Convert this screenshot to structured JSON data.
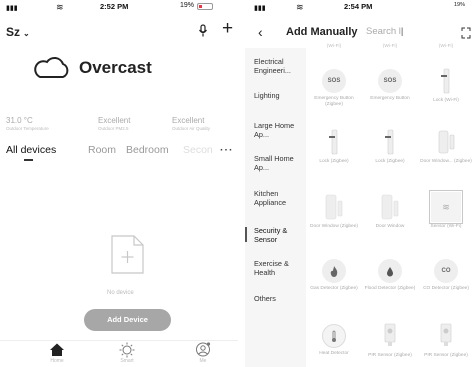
{
  "left_phone": {
    "status": {
      "signal": "▮▮▮",
      "time": "2:52 PM",
      "battery": "19%"
    },
    "header": {
      "home": "Sz",
      "chevron": "⌄"
    },
    "weather": {
      "condition": "Overcast",
      "stats": [
        {
          "value": "31.0 °C",
          "label": "Outdoor Temperature"
        },
        {
          "value": "Excellent",
          "label": "Outdoor PM2.5"
        },
        {
          "value": "Excellent",
          "label": "Outdoor Air Quality"
        }
      ]
    },
    "tabs": [
      "All devices",
      "Room",
      "Bedroom",
      "Secon",
      "···"
    ],
    "empty": {
      "text": "No device",
      "button": "Add Device"
    },
    "nav": [
      {
        "label": "Home",
        "icon": "home-icon"
      },
      {
        "label": "Smart",
        "icon": "sun-icon"
      },
      {
        "label": "Me",
        "icon": "user-icon"
      }
    ]
  },
  "right_phone": {
    "status": {
      "signal": "▮▮▮",
      "time": "2:54 PM",
      "battery": "19%"
    },
    "header": {
      "back": "‹",
      "title": "Add Manually",
      "search_placeholder": "Search l",
      "cursor": "|"
    },
    "categories": [
      "Electrical Engineeri...",
      "Lighting",
      "Large Home Ap...",
      "Small Home Ap...",
      "Kitchen Appliance",
      "Security & Sensor",
      "Exercise & Health",
      "Others"
    ],
    "selected_category": "Security & Sensor",
    "top_cut_labels": [
      "(Wi-Fi)",
      "(Wi-Fi)",
      "(Wi-Fi)"
    ],
    "products": [
      {
        "name": "SOS",
        "label": "",
        "icon": "sos-icon"
      },
      {
        "name": "SOS",
        "label": "",
        "icon": "sos-icon"
      },
      {
        "name": "",
        "label": "Lock (Wi-Fi)",
        "icon": "lock-icon"
      },
      {
        "name": "",
        "label": "Emergency Button (Zigbee)",
        "icon": ""
      },
      {
        "name": "",
        "label": "Emergency Button",
        "icon": ""
      },
      {
        "name": "",
        "label": "",
        "icon": ""
      },
      {
        "name": "",
        "label": "Lock (Zigbee)",
        "icon": "lock-icon"
      },
      {
        "name": "",
        "label": "Lock (Zigbee)",
        "icon": "lock-icon"
      },
      {
        "name": "",
        "label": "Door Window... (Zigbee)",
        "icon": "door-sensor-icon"
      },
      {
        "name": "",
        "label": "Door Window (Zigbee)",
        "icon": "door-sensor-icon"
      },
      {
        "name": "",
        "label": "Door Window",
        "icon": "door-sensor-icon"
      },
      {
        "name": "",
        "label": "Sensor (Wi-Fi)",
        "icon": "sensor-icon"
      },
      {
        "name": "",
        "label": "Gas Detector (Zigbee)",
        "icon": "flame-icon"
      },
      {
        "name": "",
        "label": "Flood Detector (Zigbee)",
        "icon": "drop-icon"
      },
      {
        "name": "CO",
        "label": "CO Detector (Zigbee)",
        "icon": "co-icon"
      },
      {
        "name": "",
        "label": "Heat Detector",
        "icon": "thermometer-icon"
      },
      {
        "name": "",
        "label": "PIR Sensor (Zigbee)",
        "icon": "pir-icon"
      },
      {
        "name": "",
        "label": "PIR Sensor (Zigbee)",
        "icon": "pir-icon"
      }
    ]
  }
}
